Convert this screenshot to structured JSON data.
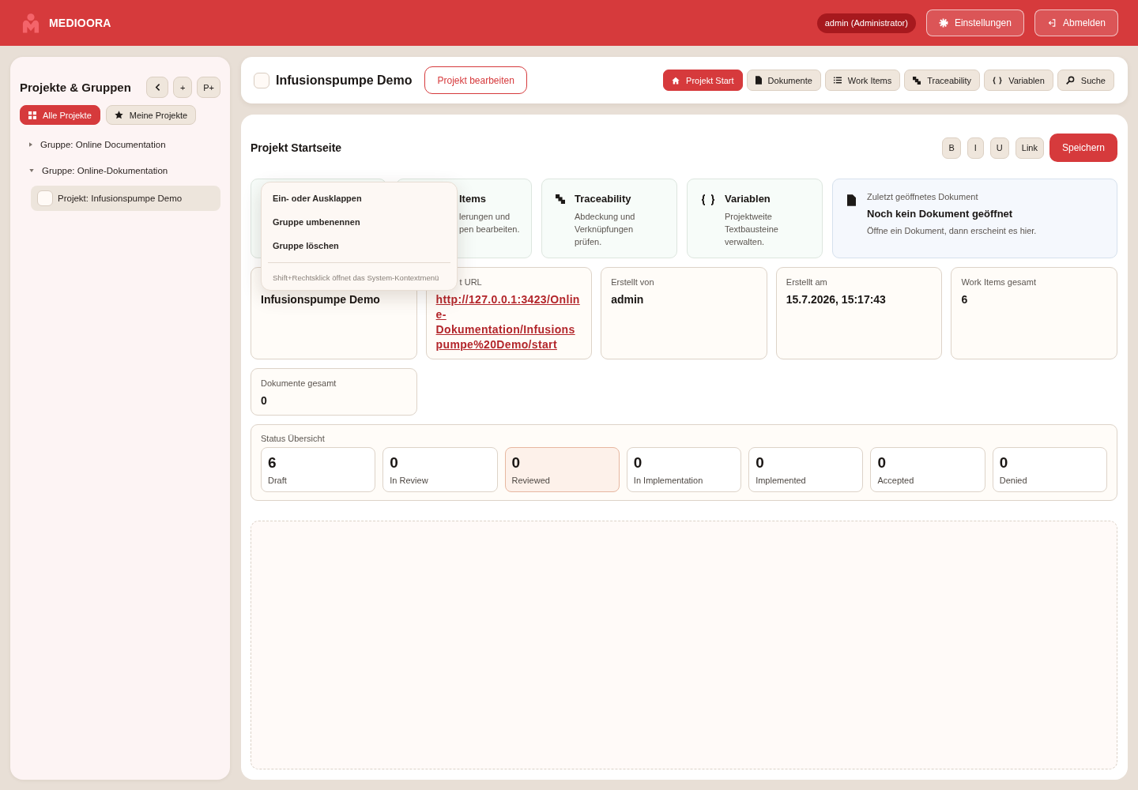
{
  "top_bar": {
    "brand": "MEDIOORA",
    "user_badge": "admin (Administrator)",
    "buttons": [
      "Einstellungen",
      "Abmelden"
    ]
  },
  "sidebar": {
    "title": "Projekte & Gruppen",
    "tool_buttons": [
      "+",
      "P+"
    ],
    "tabs": [
      {
        "label": "Alle Projekte",
        "selected": true
      },
      {
        "label": "Meine Projekte",
        "selected": false
      }
    ],
    "tree": [
      {
        "label": "Gruppe: Online Documentation",
        "expanded": false,
        "selected": false
      },
      {
        "label": "Gruppe: Online-Dokumentation",
        "expanded": true,
        "selected": false,
        "children": [
          {
            "label": "Projekt: Infusionspumpe Demo",
            "checked": false,
            "selected": true
          }
        ]
      }
    ]
  },
  "header": {
    "title": "Infusionspumpe Demo",
    "checked": false,
    "edit_button": "Projekt bearbeiten",
    "nav": [
      {
        "label": "Projekt Start",
        "selected": true
      },
      {
        "label": "Dokumente",
        "selected": false
      },
      {
        "label": "Work Items",
        "selected": false
      },
      {
        "label": "Traceability",
        "selected": false
      },
      {
        "label": "Variablen",
        "selected": false
      },
      {
        "label": "Suche",
        "selected": false
      }
    ]
  },
  "page": {
    "title": "Projekt Startseite",
    "format_buttons": [
      "B",
      "I",
      "U",
      "Link"
    ],
    "save_button": "Speichern",
    "quick_links": [
      {
        "kind": "hidden"
      },
      {
        "kind": "card",
        "partly_covered": true,
        "title": "Items",
        "description": "lerungen und pen bearbeiten."
      },
      {
        "kind": "card",
        "partly_covered": false,
        "title": "Traceability",
        "description": "Abdeckung und Verknüpfungen prüfen."
      },
      {
        "kind": "card",
        "partly_covered": false,
        "title": "Variablen",
        "description": "Projektweite Textbausteine verwalten."
      }
    ],
    "recent_document": {
      "caption": "Zuletzt geöffnetes Dokument",
      "title": "Noch kein Dokument geöffnet",
      "description": "Öffne ein Dokument, dann erscheint es hier."
    },
    "info_cards": [
      {
        "kind": "text",
        "value": "Infusionspumpe Demo"
      },
      {
        "kind": "link",
        "partly_covered": true,
        "label": "t URL",
        "value": "http://127.0.0.1:3423/Online-Dokumentation/Infusionspumpe%20Demo/start"
      },
      {
        "kind": "text",
        "partly_covered": false,
        "label": "Erstellt von",
        "value": "admin"
      },
      {
        "kind": "text",
        "partly_covered": false,
        "label": "Erstellt am",
        "value": "15.7.2026, 15:17:43"
      },
      {
        "kind": "text",
        "partly_covered": false,
        "label": "Work Items gesamt",
        "value": "6"
      },
      {
        "kind": "text",
        "partly_covered": false,
        "label": "Dokumente gesamt",
        "value": "0"
      }
    ],
    "status_overview": {
      "title": "Status Übersicht",
      "items": [
        {
          "count": "6",
          "label": "Draft",
          "selected": false
        },
        {
          "count": "0",
          "label": "In Review",
          "selected": false
        },
        {
          "count": "0",
          "label": "Reviewed",
          "selected": true
        },
        {
          "count": "0",
          "label": "In Implementation",
          "selected": false
        },
        {
          "count": "0",
          "label": "Implemented",
          "selected": false
        },
        {
          "count": "0",
          "label": "Accepted",
          "selected": false
        },
        {
          "count": "0",
          "label": "Denied",
          "selected": false
        }
      ]
    }
  },
  "context_menu": {
    "items": [
      "Ein- oder Ausklappen",
      "Gruppe umbenennen",
      "Gruppe löschen"
    ],
    "hint": "Shift+Rechtsklick öffnet das System-Kontextmenü"
  }
}
